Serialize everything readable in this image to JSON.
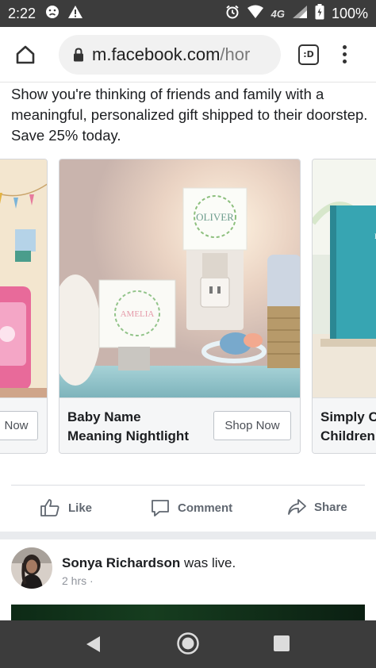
{
  "status": {
    "time": "2:22",
    "network": "4G",
    "battery": "100%"
  },
  "browser": {
    "url_domain": "m.facebook.com",
    "url_path": "/hor",
    "tab_label": ":D"
  },
  "ad": {
    "text": "Show you're thinking of friends and family with a meaningful, personalized gift shipped to their doorstep. Save 25% today."
  },
  "carousel": {
    "cards": [
      {
        "title": "",
        "button": "Now"
      },
      {
        "title": "Baby Name Meaning Nightlight",
        "title_line1": "Baby Name",
        "title_line2": "Meaning Nightlight",
        "button": "Shop Now",
        "nightlight_name_1": "OLIVER",
        "nightlight_name_2": "AMELIA"
      },
      {
        "title": "Simply C Children",
        "title_line1": "Simply C",
        "title_line2": "Children"
      }
    ]
  },
  "actions": {
    "like": "Like",
    "comment": "Comment",
    "share": "Share"
  },
  "post": {
    "author": "Sonya Richardson",
    "action": "was live.",
    "time": "2 hrs",
    "time_sep": "·"
  },
  "colors": {
    "status_bar": "#3c3c3c",
    "nav_bar": "#3c3c3c",
    "text_primary": "#1c1e21",
    "text_secondary": "#606770"
  }
}
